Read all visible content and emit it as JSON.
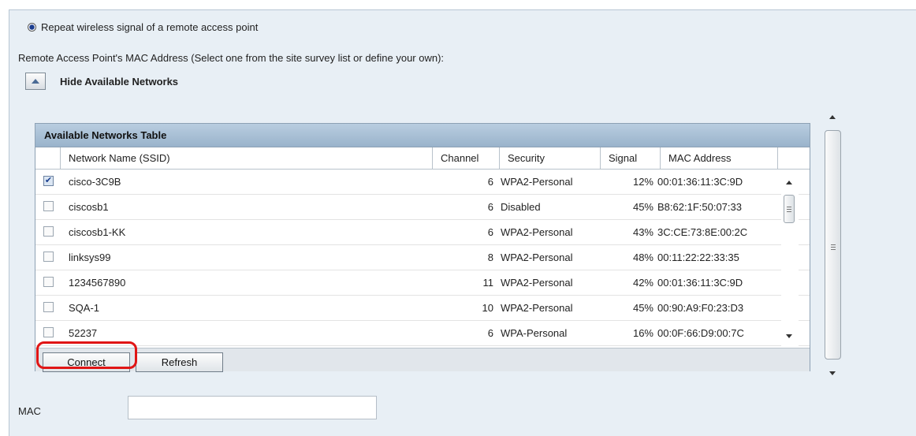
{
  "mode": {
    "radio_label": "Repeat wireless signal of a remote access point"
  },
  "remote": {
    "label": "Remote Access Point's MAC Address (Select one from the site survey list or define your own):",
    "toggle_label": "Hide Available Networks"
  },
  "networks": {
    "title": "Available Networks Table",
    "columns": [
      "Network Name (SSID)",
      "Channel",
      "Security",
      "Signal",
      "MAC Address"
    ],
    "rows": [
      {
        "checked": true,
        "ssid": "cisco-3C9B",
        "channel": "6",
        "security": "WPA2-Personal",
        "signal": "12%",
        "mac": "00:01:36:11:3C:9D"
      },
      {
        "checked": false,
        "ssid": "ciscosb1",
        "channel": "6",
        "security": "Disabled",
        "signal": "45%",
        "mac": "B8:62:1F:50:07:33"
      },
      {
        "checked": false,
        "ssid": "ciscosb1-KK",
        "channel": "6",
        "security": "WPA2-Personal",
        "signal": "43%",
        "mac": "3C:CE:73:8E:00:2C"
      },
      {
        "checked": false,
        "ssid": "linksys99",
        "channel": "8",
        "security": "WPA2-Personal",
        "signal": "48%",
        "mac": "00:11:22:22:33:35"
      },
      {
        "checked": false,
        "ssid": "1234567890",
        "channel": "11",
        "security": "WPA2-Personal",
        "signal": "42%",
        "mac": "00:01:36:11:3C:9D"
      },
      {
        "checked": false,
        "ssid": "SQA-1",
        "channel": "10",
        "security": "WPA2-Personal",
        "signal": "45%",
        "mac": "00:90:A9:F0:23:D3"
      },
      {
        "checked": false,
        "ssid": "52237",
        "channel": "6",
        "security": "WPA-Personal",
        "signal": "16%",
        "mac": "00:0F:66:D9:00:7C"
      }
    ],
    "connect_label": "Connect",
    "refresh_label": "Refresh"
  },
  "mac": {
    "label": "MAC",
    "value": ""
  },
  "colors": {
    "highlight": "#e01515",
    "table_header": "#a9c0d6",
    "panel_bg": "#e8eff5"
  }
}
